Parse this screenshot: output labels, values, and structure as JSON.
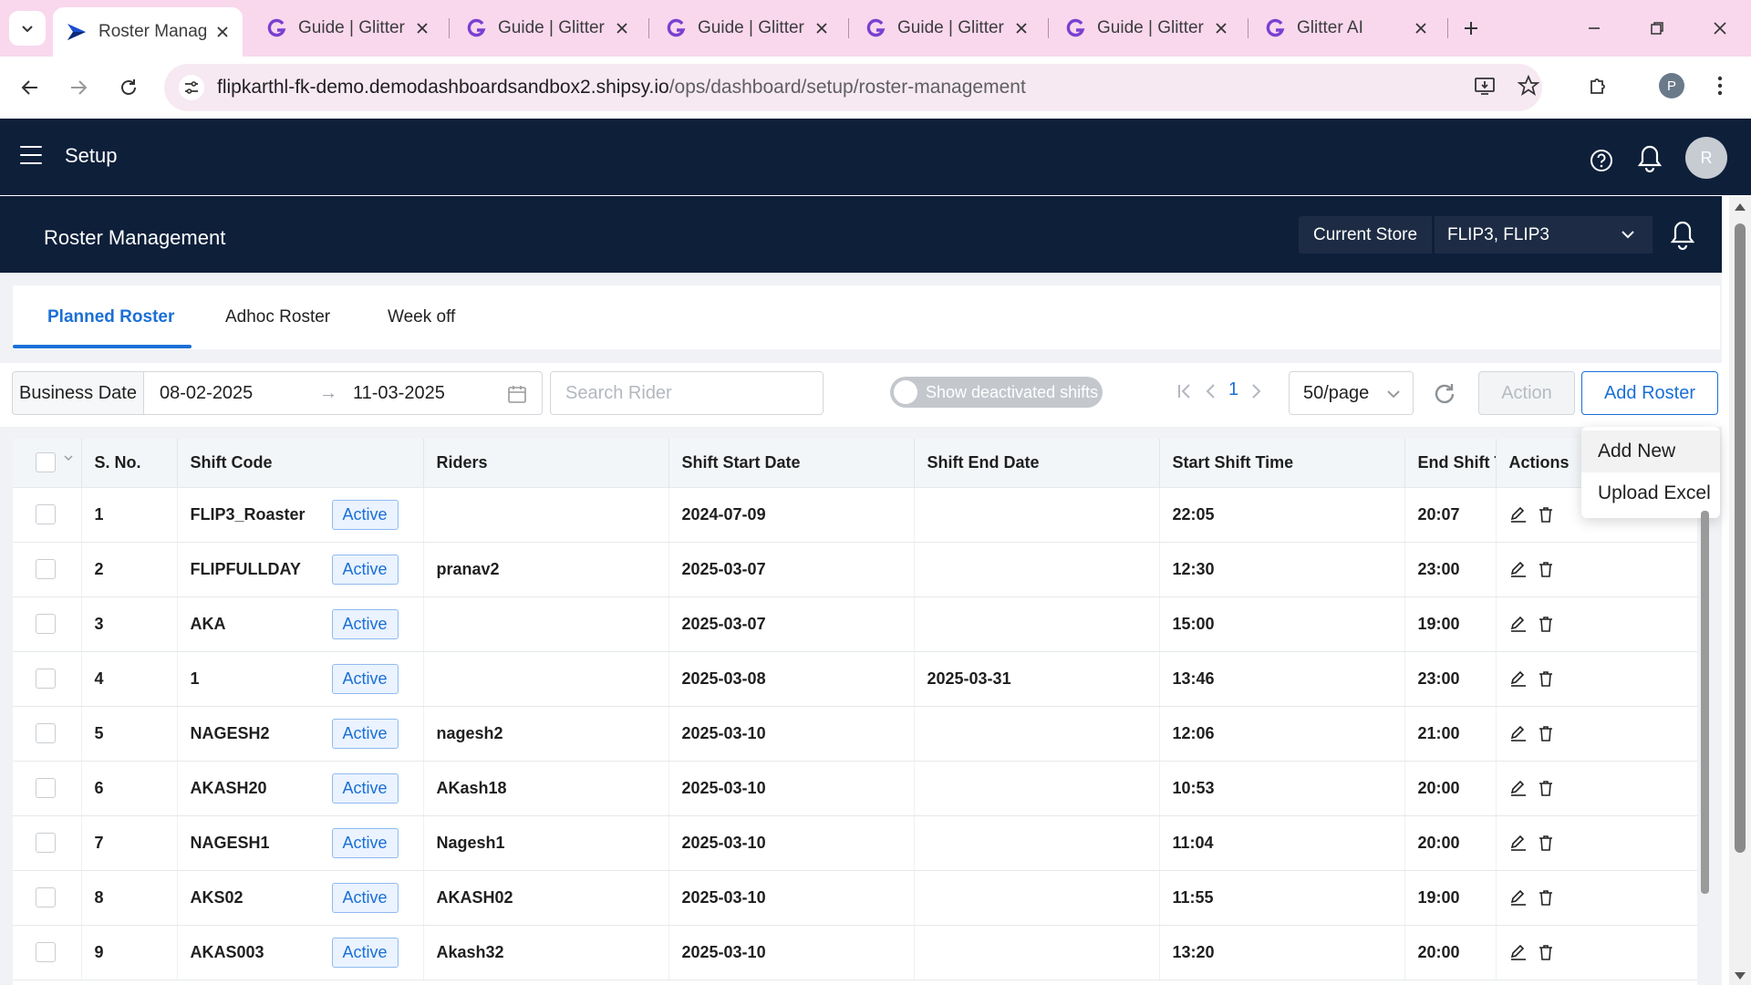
{
  "browser": {
    "tabs": [
      {
        "title": "Roster Manag",
        "active": true,
        "icon": "shipsy-logo-icon"
      },
      {
        "title": "Guide | Glitter",
        "active": false,
        "icon": "glitter-g-icon"
      },
      {
        "title": "Guide | Glitter",
        "active": false,
        "icon": "glitter-g-icon"
      },
      {
        "title": "Guide | Glitter",
        "active": false,
        "icon": "glitter-g-icon"
      },
      {
        "title": "Guide | Glitter",
        "active": false,
        "icon": "glitter-g-icon"
      },
      {
        "title": "Guide | Glitter",
        "active": false,
        "icon": "glitter-g-icon"
      },
      {
        "title": "Glitter AI",
        "active": false,
        "icon": "glitter-g-icon"
      }
    ],
    "url_host": "flipkarthl-fk-demo.demodashboardsandbox2.shipsy.io",
    "url_path": "/ops/dashboard/setup/roster-management",
    "profile_initial": "P"
  },
  "header": {
    "title": "Setup",
    "avatar_initial": "R"
  },
  "subheader": {
    "page_title": "Roster Management",
    "store_label": "Current Store",
    "store_value": "FLIP3, FLIP3"
  },
  "content_tabs": [
    {
      "label": "Planned Roster",
      "active": true
    },
    {
      "label": "Adhoc Roster",
      "active": false
    },
    {
      "label": "Week off",
      "active": false
    }
  ],
  "toolbar": {
    "business_date_label": "Business Date",
    "date_from": "08-02-2025",
    "date_to": "11-03-2025",
    "search_placeholder": "Search Rider",
    "toggle_label": "Show deactivated shifts",
    "page_number": "1",
    "page_size": "50/page",
    "action_label": "Action",
    "add_roster_label": "Add Roster"
  },
  "dropdown": {
    "items": [
      "Add New",
      "Upload Excel"
    ]
  },
  "table": {
    "columns": [
      "S. No.",
      "Shift Code",
      "Riders",
      "Shift Start Date",
      "Shift End Date",
      "Start Shift Time",
      "End Shift T",
      "Actions"
    ],
    "status_label": "Active",
    "rows": [
      {
        "sno": "1",
        "code": "FLIP3_Roaster",
        "riders": "",
        "start_date": "2024-07-09",
        "end_date": "",
        "start_time": "22:05",
        "end_time": "20:07"
      },
      {
        "sno": "2",
        "code": "FLIPFULLDAY",
        "riders": "pranav2",
        "start_date": "2025-03-07",
        "end_date": "",
        "start_time": "12:30",
        "end_time": "23:00"
      },
      {
        "sno": "3",
        "code": "AKA",
        "riders": "",
        "start_date": "2025-03-07",
        "end_date": "",
        "start_time": "15:00",
        "end_time": "19:00"
      },
      {
        "sno": "4",
        "code": "1",
        "riders": "",
        "start_date": "2025-03-08",
        "end_date": "2025-03-31",
        "start_time": "13:46",
        "end_time": "23:00"
      },
      {
        "sno": "5",
        "code": "NAGESH2",
        "riders": "nagesh2",
        "start_date": "2025-03-10",
        "end_date": "",
        "start_time": "12:06",
        "end_time": "21:00"
      },
      {
        "sno": "6",
        "code": "AKASH20",
        "riders": "AKash18",
        "start_date": "2025-03-10",
        "end_date": "",
        "start_time": "10:53",
        "end_time": "20:00"
      },
      {
        "sno": "7",
        "code": "NAGESH1",
        "riders": "Nagesh1",
        "start_date": "2025-03-10",
        "end_date": "",
        "start_time": "11:04",
        "end_time": "20:00"
      },
      {
        "sno": "8",
        "code": "AKS02",
        "riders": "AKASH02",
        "start_date": "2025-03-10",
        "end_date": "",
        "start_time": "11:55",
        "end_time": "19:00"
      },
      {
        "sno": "9",
        "code": "AKAS003",
        "riders": "Akash32",
        "start_date": "2025-03-10",
        "end_date": "",
        "start_time": "13:20",
        "end_time": "20:00"
      }
    ]
  },
  "colors": {
    "header_bg": "#0e1f3a",
    "accent": "#1a6fd6",
    "tabstrip_bg": "#f9d8ee"
  }
}
